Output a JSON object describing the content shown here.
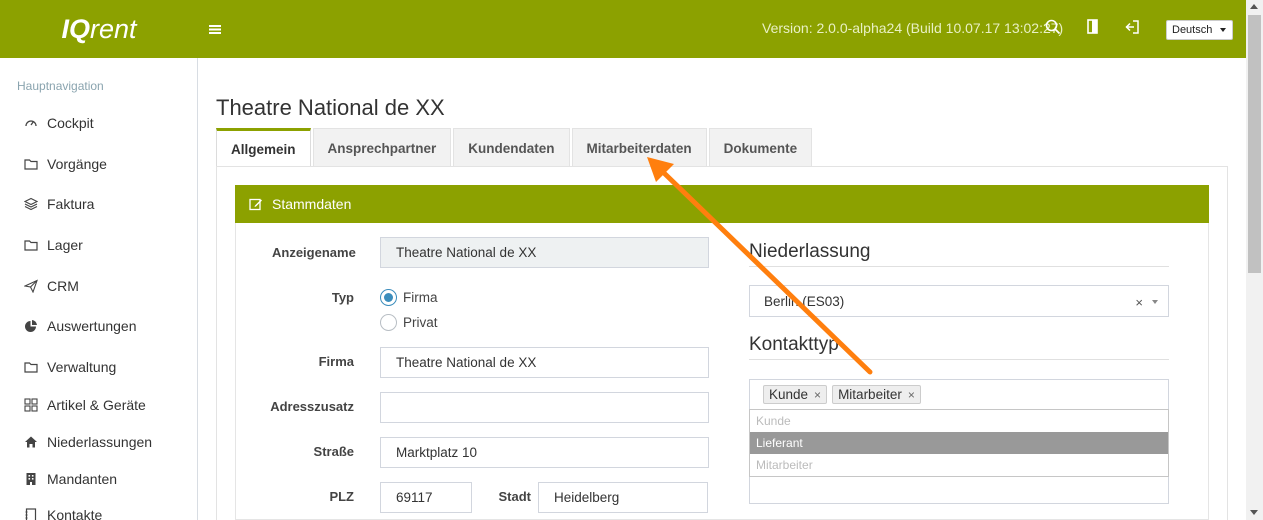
{
  "header": {
    "logo_iq": "IQ",
    "logo_rent": "rent",
    "version": "Version: 2.0.0-alpha24 (Build 10.07.17 13:02:27)",
    "language": "Deutsch",
    "brand_color": "#8ca100",
    "icons": [
      "menu-icon",
      "search-icon",
      "sidebar-toggle-icon",
      "logout-icon"
    ]
  },
  "sidebar": {
    "heading": "Hauptnavigation",
    "items": [
      {
        "label": "Cockpit",
        "icon": "gauge-icon"
      },
      {
        "label": "Vorgänge",
        "icon": "folder-icon"
      },
      {
        "label": "Faktura",
        "icon": "layers-icon"
      },
      {
        "label": "Lager",
        "icon": "folder-icon"
      },
      {
        "label": "CRM",
        "icon": "paper-plane-icon"
      },
      {
        "label": "Auswertungen",
        "icon": "pie-chart-icon"
      },
      {
        "label": "Verwaltung",
        "icon": "folder-icon"
      },
      {
        "label": "Artikel & Geräte",
        "icon": "grid-icon"
      },
      {
        "label": "Niederlassungen",
        "icon": "home-icon"
      },
      {
        "label": "Mandanten",
        "icon": "building-icon"
      },
      {
        "label": "Kontakte",
        "icon": "contact-book-icon"
      }
    ]
  },
  "page": {
    "title": "Theatre National de XX",
    "tabs": [
      "Allgemein",
      "Ansprechpartner",
      "Kundendaten",
      "Mitarbeiterdaten",
      "Dokumente"
    ],
    "active_tab": "Allgemein"
  },
  "stammdaten": {
    "title": "Stammdaten",
    "anzeigename_label": "Anzeigename",
    "anzeigename_value": "Theatre National de XX",
    "typ_label": "Typ",
    "typ_options": [
      "Firma",
      "Privat"
    ],
    "typ_selected": "Firma",
    "firma_label": "Firma",
    "firma_value": "Theatre National de XX",
    "adresszusatz_label": "Adresszusatz",
    "adresszusatz_value": "",
    "strasse_label": "Straße",
    "strasse_value": "Marktplatz 10",
    "plz_label": "PLZ",
    "plz_value": "69117",
    "stadt_label": "Stadt",
    "stadt_value": "Heidelberg"
  },
  "niederlassung": {
    "title": "Niederlassung",
    "selected": "Berlin (ES03)",
    "clear_glyph": "×"
  },
  "kontakttyp": {
    "title": "Kontakttyp",
    "tags": [
      "Kunde",
      "Mitarbeiter"
    ],
    "remove_glyph": "×",
    "options": [
      "Kunde",
      "Lieferant",
      "Mitarbeiter"
    ],
    "highlighted": "Lieferant"
  },
  "annotation": {
    "arrow_color": "#ff7f0e"
  }
}
